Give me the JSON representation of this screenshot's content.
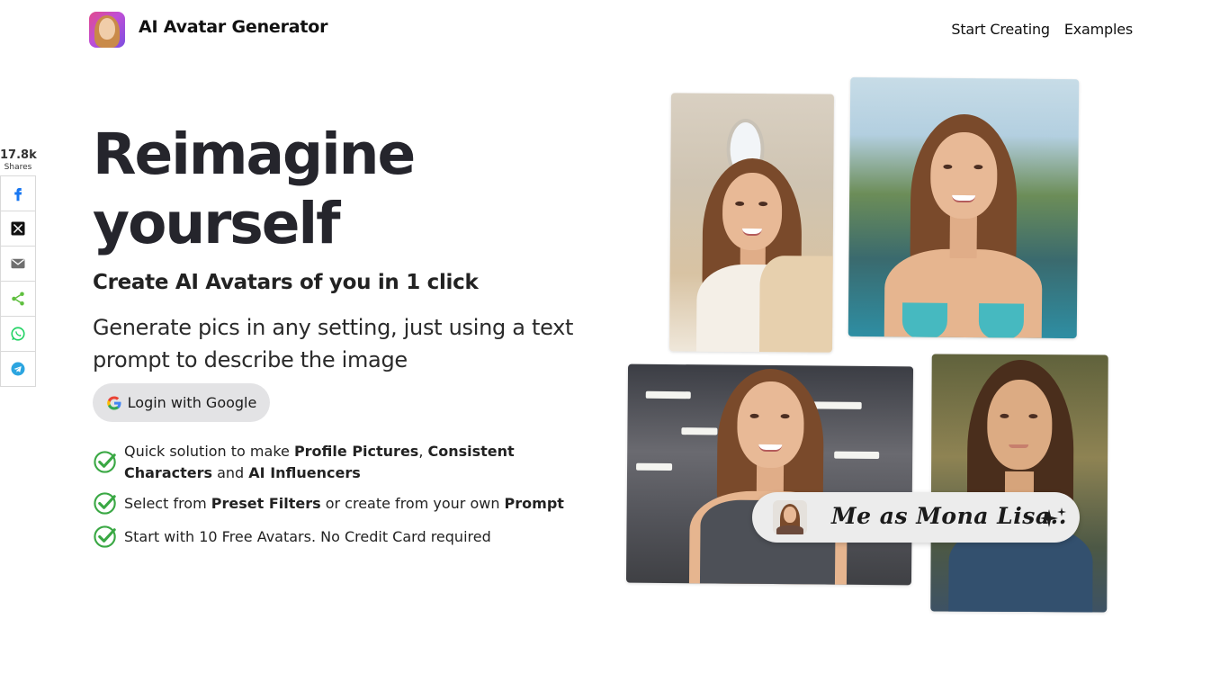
{
  "header": {
    "brand": "AI Avatar Generator",
    "nav": [
      "Start Creating",
      "Examples"
    ]
  },
  "share": {
    "count": "17.8k",
    "label": "Shares",
    "buttons": [
      "facebook-icon",
      "x-icon",
      "email-icon",
      "share-icon",
      "whatsapp-icon",
      "telegram-icon"
    ]
  },
  "hero": {
    "title_line1": "Reimagine",
    "title_line2": "yourself",
    "subtitle": "Create AI Avatars of you in 1 click",
    "description": "Generate pics in any setting, just using a text prompt to describe the image",
    "login_button": "Login with Google"
  },
  "features": [
    {
      "parts": [
        {
          "text": "Quick solution to make ",
          "bold": false
        },
        {
          "text": "Profile Pictures",
          "bold": true
        },
        {
          "text": ", ",
          "bold": false
        },
        {
          "text": "Consistent Characters",
          "bold": true
        },
        {
          "text": " and ",
          "bold": false
        },
        {
          "text": "AI Influencers",
          "bold": true
        }
      ]
    },
    {
      "parts": [
        {
          "text": "Select from ",
          "bold": false
        },
        {
          "text": "Preset Filters",
          "bold": true
        },
        {
          "text": " or create from your own ",
          "bold": false
        },
        {
          "text": "Prompt",
          "bold": true
        }
      ]
    },
    {
      "parts": [
        {
          "text": "Start with 10 Free Avatars. No Credit Card required",
          "bold": false
        }
      ]
    }
  ],
  "prompt_pill": {
    "text": "Me as Mona Lisa.."
  },
  "colors": {
    "title": "#25252c",
    "button_bg": "#e3e3e5",
    "check_green": "#3aa844",
    "facebook": "#1877f2",
    "whatsapp": "#25d366",
    "telegram": "#2ca5e0",
    "share_green": "#5fbf3f"
  }
}
